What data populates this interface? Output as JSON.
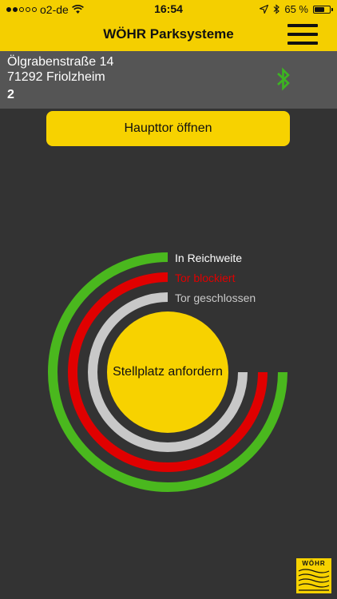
{
  "statusbar": {
    "carrier": "o2-de",
    "time": "16:54",
    "battery": "65 %",
    "battery_level": 0.65
  },
  "navbar": {
    "title": "WÖHR Parksysteme"
  },
  "location": {
    "street": "Ölgrabenstraße 14",
    "city": "71292 Friolzheim",
    "number": "2"
  },
  "actions": {
    "main_gate": "Haupttor öffnen",
    "request_spot": "Stellplatz anfordern"
  },
  "legend": {
    "in_range": "In Reichweite",
    "gate_blocked": "Tor blockiert",
    "gate_closed": "Tor geschlossen"
  },
  "logo": {
    "text": "WÖHR"
  },
  "colors": {
    "brand_yellow": "#f7d200",
    "in_range": "#4ab81e",
    "blocked": "#e00000",
    "closed": "#c8c8c8",
    "bluetooth": "#3cb521"
  }
}
